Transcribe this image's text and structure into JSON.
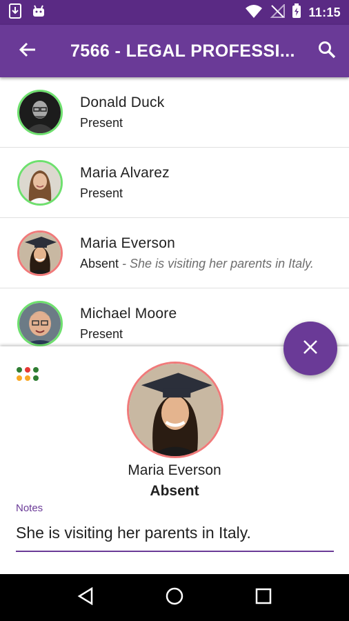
{
  "status_bar": {
    "time": "11:15",
    "icons": [
      "download-icon",
      "android-icon",
      "wifi-icon",
      "no-signal-icon",
      "battery-charging-icon"
    ]
  },
  "app_bar": {
    "title": "7566 - LEGAL PROFESSI...",
    "back_icon": "arrow-back-icon",
    "search_icon": "search-icon",
    "color": "#6a3a97"
  },
  "students": [
    {
      "name": "Donald Duck",
      "status": "Present",
      "note": ""
    },
    {
      "name": "Maria Alvarez",
      "status": "Present",
      "note": ""
    },
    {
      "name": "Maria Everson",
      "status": "Absent",
      "note": " - She is visiting her parents in Italy."
    },
    {
      "name": "Michael Moore",
      "status": "Present",
      "note": ""
    }
  ],
  "status_colors": {
    "present": "#6ee06e",
    "absent": "#f07a7a"
  },
  "fab": {
    "icon": "close-icon"
  },
  "detail": {
    "name": "Maria Everson",
    "status": "Absent",
    "notes_label": "Notes",
    "notes_value": "She is visiting her parents in Italy.",
    "status_dot_colors": [
      "#2e7d32",
      "#e53935",
      "#2e7d32",
      "#f9a825",
      "#f9a825",
      "#2e7d32"
    ]
  },
  "nav_bar": {
    "icons": [
      "back-triangle-icon",
      "home-circle-icon",
      "recents-square-icon"
    ]
  }
}
